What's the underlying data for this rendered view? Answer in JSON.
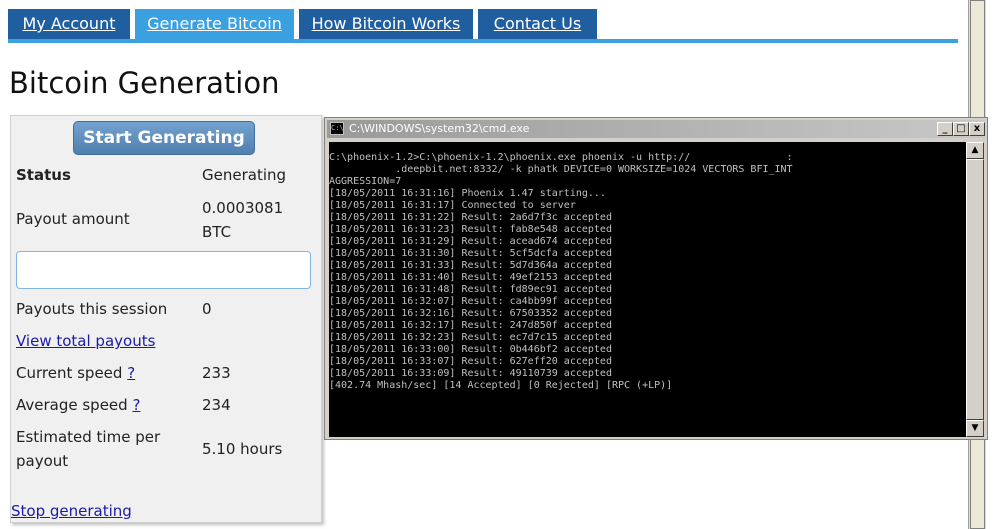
{
  "nav": {
    "tabs": [
      {
        "label": "My Account",
        "active": false
      },
      {
        "label": "Generate Bitcoin",
        "active": true
      },
      {
        "label": "How Bitcoin Works",
        "active": false
      },
      {
        "label": "Contact Us",
        "active": false
      }
    ]
  },
  "page": {
    "title": "Bitcoin Generation"
  },
  "panel": {
    "start_button": "Start Generating",
    "status_label": "Status",
    "status_value": "Generating",
    "payout_label": "Payout amount",
    "payout_value_line1": "0.0003081",
    "payout_value_line2": "BTC",
    "progress_percent": 0,
    "payouts_session_label": "Payouts this session",
    "payouts_session_value": "0",
    "view_total_link": "View total payouts",
    "current_speed_label": "Current speed",
    "current_speed_value": "233",
    "average_speed_label": "Average speed",
    "average_speed_value": "234",
    "help_mark": "?",
    "eta_label_line1": "Estimated time per",
    "eta_label_line2": "payout",
    "eta_value": "5.10 hours",
    "stop_link": "Stop generating"
  },
  "cmd": {
    "title": "C:\\WINDOWS\\system32\\cmd.exe",
    "controls": {
      "minimize": "_",
      "maximize": "□",
      "close": "x"
    },
    "scroll_up": "▲",
    "scroll_down": "▼",
    "lines": [
      "C:\\phoenix-1.2>C:\\phoenix-1.2\\phoenix.exe phoenix -u http://                :",
      "           .deepbit.net:8332/ -k phatk DEVICE=0 WORKSIZE=1024 VECTORS BFI_INT",
      "AGGRESSION=7",
      "[18/05/2011 16:31:16] Phoenix 1.47 starting...",
      "[18/05/2011 16:31:17] Connected to server",
      "[18/05/2011 16:31:22] Result: 2a6d7f3c accepted",
      "[18/05/2011 16:31:23] Result: fab8e548 accepted",
      "[18/05/2011 16:31:29] Result: acead674 accepted",
      "[18/05/2011 16:31:30] Result: 5cf5dcfa accepted",
      "[18/05/2011 16:31:33] Result: 5d7d364a accepted",
      "[18/05/2011 16:31:40] Result: 49ef2153 accepted",
      "[18/05/2011 16:31:48] Result: fd89ec91 accepted",
      "[18/05/2011 16:32:07] Result: ca4bb99f accepted",
      "[18/05/2011 16:32:16] Result: 67503352 accepted",
      "[18/05/2011 16:32:17] Result: 247d850f accepted",
      "[18/05/2011 16:32:23] Result: ec7d7c15 accepted",
      "[18/05/2011 16:33:00] Result: 0b446bf2 accepted",
      "[18/05/2011 16:33:07] Result: 627eff20 accepted",
      "[18/05/2011 16:33:09] Result: 49110739 accepted",
      "[402.74 Mhash/sec] [14 Accepted] [0 Rejected] [RPC (+LP)]"
    ]
  },
  "colors": {
    "tab": "#1f5fa0",
    "tab_active": "#3aa0e0",
    "button": "#5c8cbc",
    "link": "#1a1aa8"
  }
}
